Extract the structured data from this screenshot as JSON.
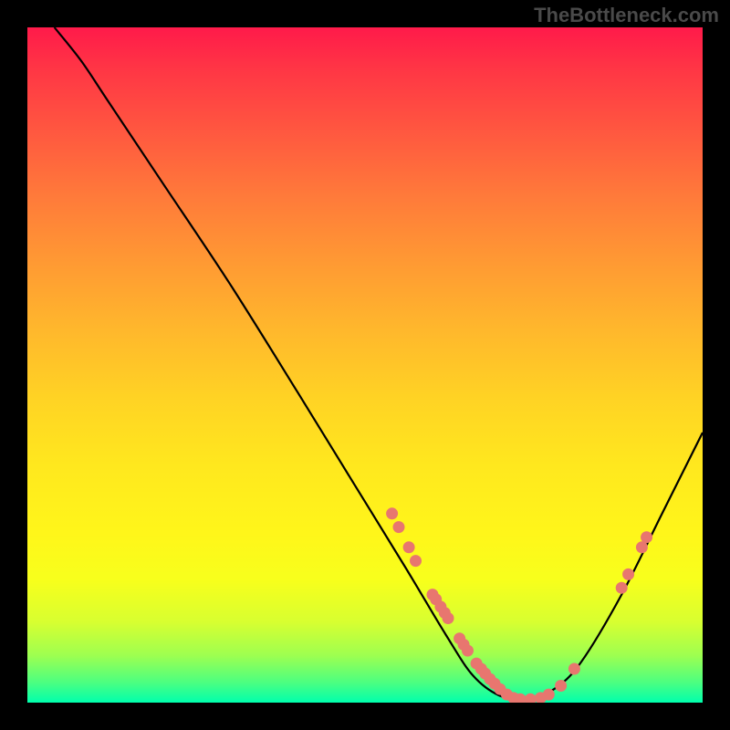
{
  "watermark": "TheBottleneck.com",
  "chart_data": {
    "type": "line",
    "title": "",
    "xlabel": "",
    "ylabel": "",
    "xlim": [
      0,
      100
    ],
    "ylim": [
      0,
      100
    ],
    "curve": [
      {
        "x": 4,
        "y": 100
      },
      {
        "x": 8,
        "y": 95
      },
      {
        "x": 12,
        "y": 89
      },
      {
        "x": 20,
        "y": 77
      },
      {
        "x": 30,
        "y": 62
      },
      {
        "x": 40,
        "y": 46
      },
      {
        "x": 48,
        "y": 33
      },
      {
        "x": 56,
        "y": 20
      },
      {
        "x": 62,
        "y": 10
      },
      {
        "x": 66,
        "y": 4
      },
      {
        "x": 70,
        "y": 1
      },
      {
        "x": 74,
        "y": 0.5
      },
      {
        "x": 78,
        "y": 2
      },
      {
        "x": 82,
        "y": 6
      },
      {
        "x": 88,
        "y": 16
      },
      {
        "x": 94,
        "y": 28
      },
      {
        "x": 100,
        "y": 40
      }
    ],
    "points": [
      {
        "x": 54,
        "y": 28
      },
      {
        "x": 55,
        "y": 26
      },
      {
        "x": 56.5,
        "y": 23
      },
      {
        "x": 57.5,
        "y": 21
      },
      {
        "x": 60,
        "y": 16
      },
      {
        "x": 60.5,
        "y": 15.3
      },
      {
        "x": 61.2,
        "y": 14.2
      },
      {
        "x": 61.8,
        "y": 13.3
      },
      {
        "x": 62.3,
        "y": 12.5
      },
      {
        "x": 64,
        "y": 9.5
      },
      {
        "x": 64.6,
        "y": 8.6
      },
      {
        "x": 65.2,
        "y": 7.7
      },
      {
        "x": 66.5,
        "y": 5.8
      },
      {
        "x": 67.2,
        "y": 5
      },
      {
        "x": 67.8,
        "y": 4.3
      },
      {
        "x": 68.5,
        "y": 3.5
      },
      {
        "x": 69.2,
        "y": 2.8
      },
      {
        "x": 70,
        "y": 2
      },
      {
        "x": 71,
        "y": 1.2
      },
      {
        "x": 72,
        "y": 0.7
      },
      {
        "x": 73,
        "y": 0.5
      },
      {
        "x": 74.5,
        "y": 0.5
      },
      {
        "x": 76,
        "y": 0.7
      },
      {
        "x": 77.2,
        "y": 1.2
      },
      {
        "x": 79,
        "y": 2.5
      },
      {
        "x": 81,
        "y": 5
      },
      {
        "x": 88,
        "y": 17
      },
      {
        "x": 89,
        "y": 19
      },
      {
        "x": 91,
        "y": 23
      },
      {
        "x": 91.7,
        "y": 24.5
      }
    ],
    "gradient_stops": [
      {
        "pos": 0,
        "color": "#ff1a4a"
      },
      {
        "pos": 50,
        "color": "#ffd324"
      },
      {
        "pos": 100,
        "color": "#00ffad"
      }
    ],
    "point_color": "#e8766f",
    "curve_color": "#000000"
  }
}
